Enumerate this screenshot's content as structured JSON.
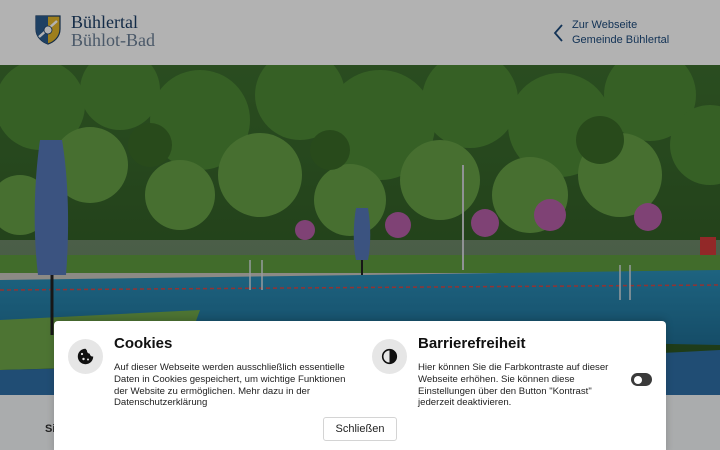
{
  "header": {
    "brand_line1": "Bühlertal",
    "brand_line2": "Bühlot-Bad",
    "back_link_line1": "Zur Webseite",
    "back_link_line2": "Gemeinde Bühlertal"
  },
  "content": {
    "partial_text": "Si"
  },
  "consent": {
    "cookies": {
      "title": "Cookies",
      "text": "Auf dieser Webseite werden ausschließlich es­sentielle Daten in Cookies gespeichert, um wichtige Funktionen der Website zu ermögli­chen. Mehr dazu in der Datenschutzerklärung"
    },
    "accessibility": {
      "title": "Barrierefreiheit",
      "text": "Hier können Sie die Farbkontraste auf die­ser Webseite erhöhen. Sie können diese Einstellungen über den Button \"Kontrast\" jederzeit deaktivieren.",
      "contrast_enabled": false
    },
    "close_label": "Schließen"
  },
  "colors": {
    "brand_dark": "#1c3e66",
    "brand_light": "#6b7f95",
    "link": "#1c4a7c",
    "toggle": "#3a3a3a"
  },
  "icons": {
    "logo": "coat-of-arms-icon",
    "back": "chevron-left-icon",
    "cookies": "cookie-icon",
    "accessibility": "contrast-icon"
  }
}
